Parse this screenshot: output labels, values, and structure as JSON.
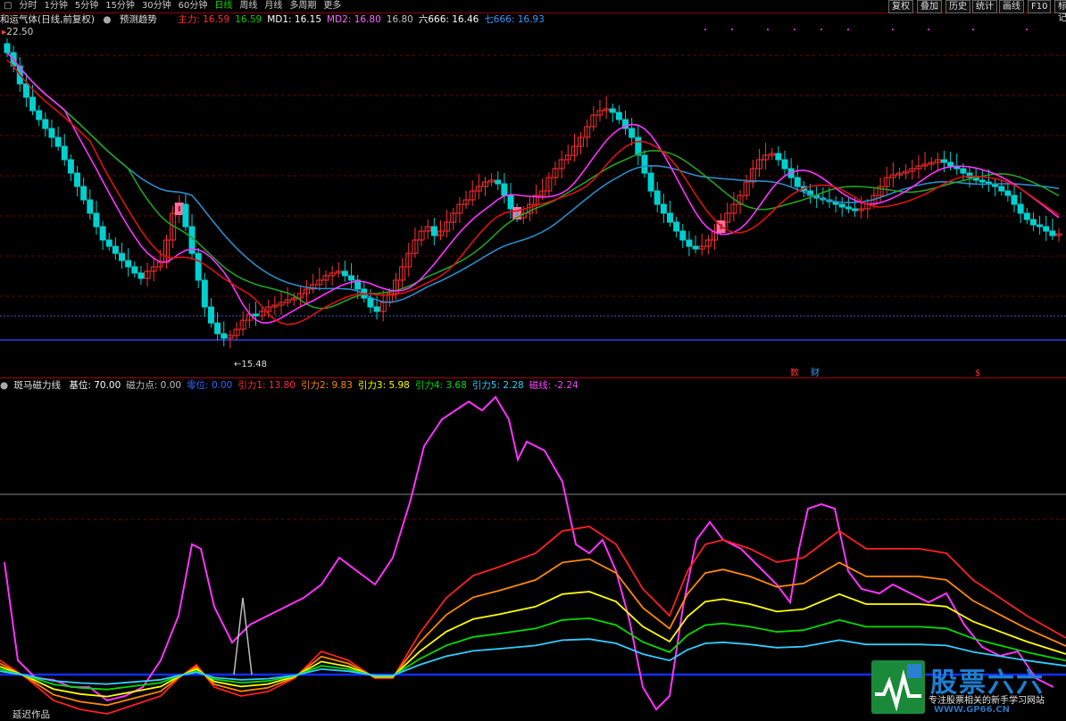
{
  "toolbar": {
    "left_icon": "chart-menu-icon",
    "periods": [
      "分时",
      "1分钟",
      "5分钟",
      "15分钟",
      "30分钟",
      "60分钟",
      "日线",
      "周线",
      "月线",
      "多周期",
      "更多"
    ],
    "active_period": "日线",
    "right_buttons": [
      "复权",
      "叠加",
      "历史",
      "统计",
      "画线",
      "F10",
      "标记"
    ]
  },
  "info_bar": {
    "main_title": "和运气体(日线,前复权)",
    "pred_label": "预测趋势",
    "items": [
      {
        "text": "主力: 16.59",
        "color": "#ff3030"
      },
      {
        "text": "16.59",
        "color": "#00d000"
      },
      {
        "text": "MD1: 16.15",
        "color": "#ffffff"
      },
      {
        "text": "MD2: 16.80",
        "color": "#ff66ff"
      },
      {
        "text": "16.80",
        "color": "#c0c0c0"
      },
      {
        "text": "六666: 16.46",
        "color": "#ffffff"
      },
      {
        "text": "七666: 16.93",
        "color": "#3399ff"
      }
    ]
  },
  "price_top_label": "22.50",
  "low_price_label": "←15.48",
  "markers": {
    "event_a": "数",
    "event_b": "财",
    "event_c": "$"
  },
  "lower_info": {
    "title": "斑马磁力线",
    "items": [
      {
        "text": "基位: 70.00",
        "color": "#ffffff"
      },
      {
        "text": "磁力点: 0.00",
        "color": "#c0c0c0"
      },
      {
        "text": "零位: 0.00",
        "color": "#3366ff"
      },
      {
        "text": "引力1: 13.80",
        "color": "#ff3030"
      },
      {
        "text": "引力2: 9.83",
        "color": "#ff8800"
      },
      {
        "text": "引力3: 5.98",
        "color": "#ffff00"
      },
      {
        "text": "引力4: 3.68",
        "color": "#00dd00"
      },
      {
        "text": "引力5: 2.28",
        "color": "#33ccff"
      },
      {
        "text": "磁线: -2.24",
        "color": "#ff44ff"
      }
    ]
  },
  "bottom_label": "延迟作品",
  "watermark": {
    "title": "股票六六",
    "subtitle": "专注股票相关的新手学习网站",
    "url": "WWW.GP66.CN"
  },
  "colors": {
    "up": "#ff3030",
    "down": "#00d0d0",
    "ma_red": "#e01010",
    "ma_pink": "#ff33ff",
    "ma_green": "#22a022",
    "ma_blue": "#2a8cc8",
    "grid": "#7a0000"
  }
}
